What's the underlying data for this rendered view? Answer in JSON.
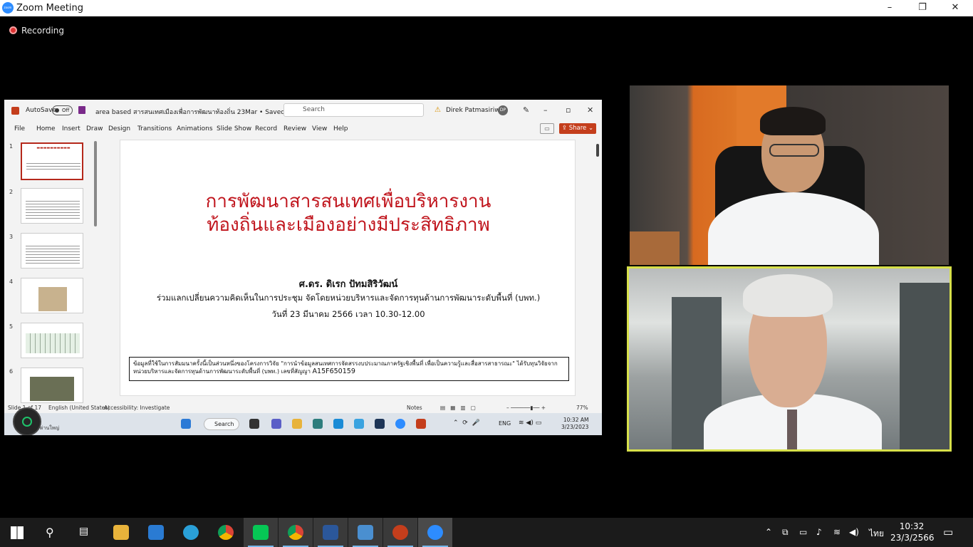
{
  "window": {
    "title": "Zoom Meeting",
    "minimize": "–",
    "restore": "❐",
    "close": "✕"
  },
  "recording": {
    "label": "Recording"
  },
  "ppt": {
    "autosave_label": "AutoSave",
    "autosave_state": "Off",
    "doc_name": "area based สารสนเทศเมืองเพื่อการพัฒนาท้องถิ่น 23Mar • Saved to this PC ⌄",
    "search_placeholder": "Search",
    "user_name": "Direk Patmasiriwat",
    "user_initials": "DP",
    "menu": [
      "File",
      "Home",
      "Insert",
      "Draw",
      "Design",
      "Transitions",
      "Animations",
      "Slide Show",
      "Record",
      "Review",
      "View",
      "Help"
    ],
    "share_label": "Share",
    "thumb_numbers": [
      "1",
      "2",
      "3",
      "4",
      "5",
      "6"
    ],
    "slide": {
      "title_line1": "การพัฒนาสารสนเทศเพื่อบริหารงาน",
      "title_line2": "ท้องถิ่นและเมืองอย่างมีประสิทธิภาพ",
      "author": "ศ.ดร. ดิเรก ปัทมสิริวัฒน์",
      "event": "ร่วมแลกเปลี่ยนความคิดเห็นในการประชุม จัดโดยหน่วยบริหารและจัดการทุนด้านการพัฒนาระดับพื้นที่ (บพท.)",
      "date": "วันที่ 23 มีนาคม 2566 เวลา 10.30-12.00",
      "footer": "ข้อมูลที่ใช้ในการสัมมนาครั้งนี้เป็นส่วนหนึ่งของโครงการวิจัย \"การนำข้อมูลสนเทศการจัดสรรงบประมาณภาครัฐเชิงพื้นที่ เพื่อเป็นความรู้และสื่อสารสาธารณะ\" ได้รับทุนวิจัยจากหน่วยบริหารและจัดการทุนด้านการพัฒนาระดับพื้นที่ (บพท.) เลขที่สัญญา",
      "contract_no": "A15F650159"
    },
    "status": {
      "slide": "Slide 1 of 17",
      "language": "English (United States)",
      "accessibility": "Accessibility: Investigate",
      "notes": "Notes",
      "zoom": "77%"
    },
    "inner_taskbar": {
      "search": "Search",
      "lang": "ENG",
      "time": "10:32 AM",
      "date": "3/23/2023",
      "corner_text": "ด่านใหญ่"
    }
  },
  "taskbar": {
    "apps": [
      "start-icon",
      "search-icon",
      "task-view-icon",
      "file-explorer-icon",
      "mail-icon",
      "edge-icon",
      "chrome-icon",
      "line-icon",
      "chrome-icon-2",
      "word-icon",
      "photos-icon",
      "powerpoint-icon",
      "zoom-icon"
    ],
    "input_lang": "ไทย",
    "time": "10:32",
    "date": "23/3/2566"
  },
  "colors": {
    "slide_title": "#c0141c",
    "active_speaker_border": "#d7e04a",
    "ppt_brand": "#c43e1c",
    "zoom_blue": "#2D8CFF"
  }
}
